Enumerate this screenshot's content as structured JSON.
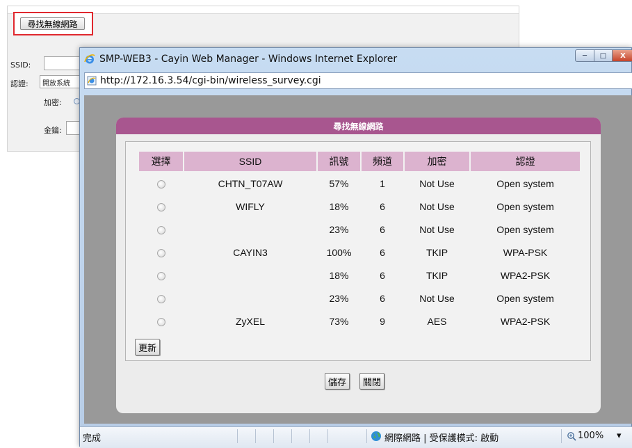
{
  "background_form": {
    "find_button": "尋找無線網路",
    "ssid_label": "SSID:",
    "auth_label": "認證:",
    "auth_select_value": "開放系統",
    "encrypt_label": "加密:",
    "key_label": "金鑰:"
  },
  "browser": {
    "title": "SMP-WEB3 - Cayin Web Manager - Windows Internet Explorer",
    "address": "http://172.16.3.54/cgi-bin/wireless_survey.cgi",
    "window_controls": {
      "minimize": "─",
      "maximize": "□",
      "close": "X"
    }
  },
  "dialog": {
    "title": "尋找無線網路",
    "columns": [
      "選擇",
      "SSID",
      "訊號",
      "頻道",
      "加密",
      "認證"
    ],
    "rows": [
      {
        "ssid": "CHTN_T07AW",
        "signal": "57%",
        "channel": "1",
        "encryption": "Not Use",
        "auth": "Open system"
      },
      {
        "ssid": "WIFLY",
        "signal": "18%",
        "channel": "6",
        "encryption": "Not Use",
        "auth": "Open system"
      },
      {
        "ssid": "",
        "signal": "23%",
        "channel": "6",
        "encryption": "Not Use",
        "auth": "Open system"
      },
      {
        "ssid": "CAYIN3",
        "signal": "100%",
        "channel": "6",
        "encryption": "TKIP",
        "auth": "WPA-PSK"
      },
      {
        "ssid": "",
        "signal": "18%",
        "channel": "6",
        "encryption": "TKIP",
        "auth": "WPA2-PSK"
      },
      {
        "ssid": "",
        "signal": "23%",
        "channel": "6",
        "encryption": "Not Use",
        "auth": "Open system"
      },
      {
        "ssid": "ZyXEL",
        "signal": "73%",
        "channel": "9",
        "encryption": "AES",
        "auth": "WPA2-PSK"
      }
    ],
    "refresh_button": "更新",
    "save_button": "儲存",
    "close_button": "關閉"
  },
  "status_bar": {
    "status": "完成",
    "zone": "網際網路 | 受保護模式: 啟動",
    "zoom": "100%",
    "zoom_dropdown": "▾"
  },
  "colors": {
    "dialog_header": "#a8568f",
    "table_header": "#dcb3cf",
    "content_bg": "#999999",
    "highlight_border": "#e0282e"
  }
}
